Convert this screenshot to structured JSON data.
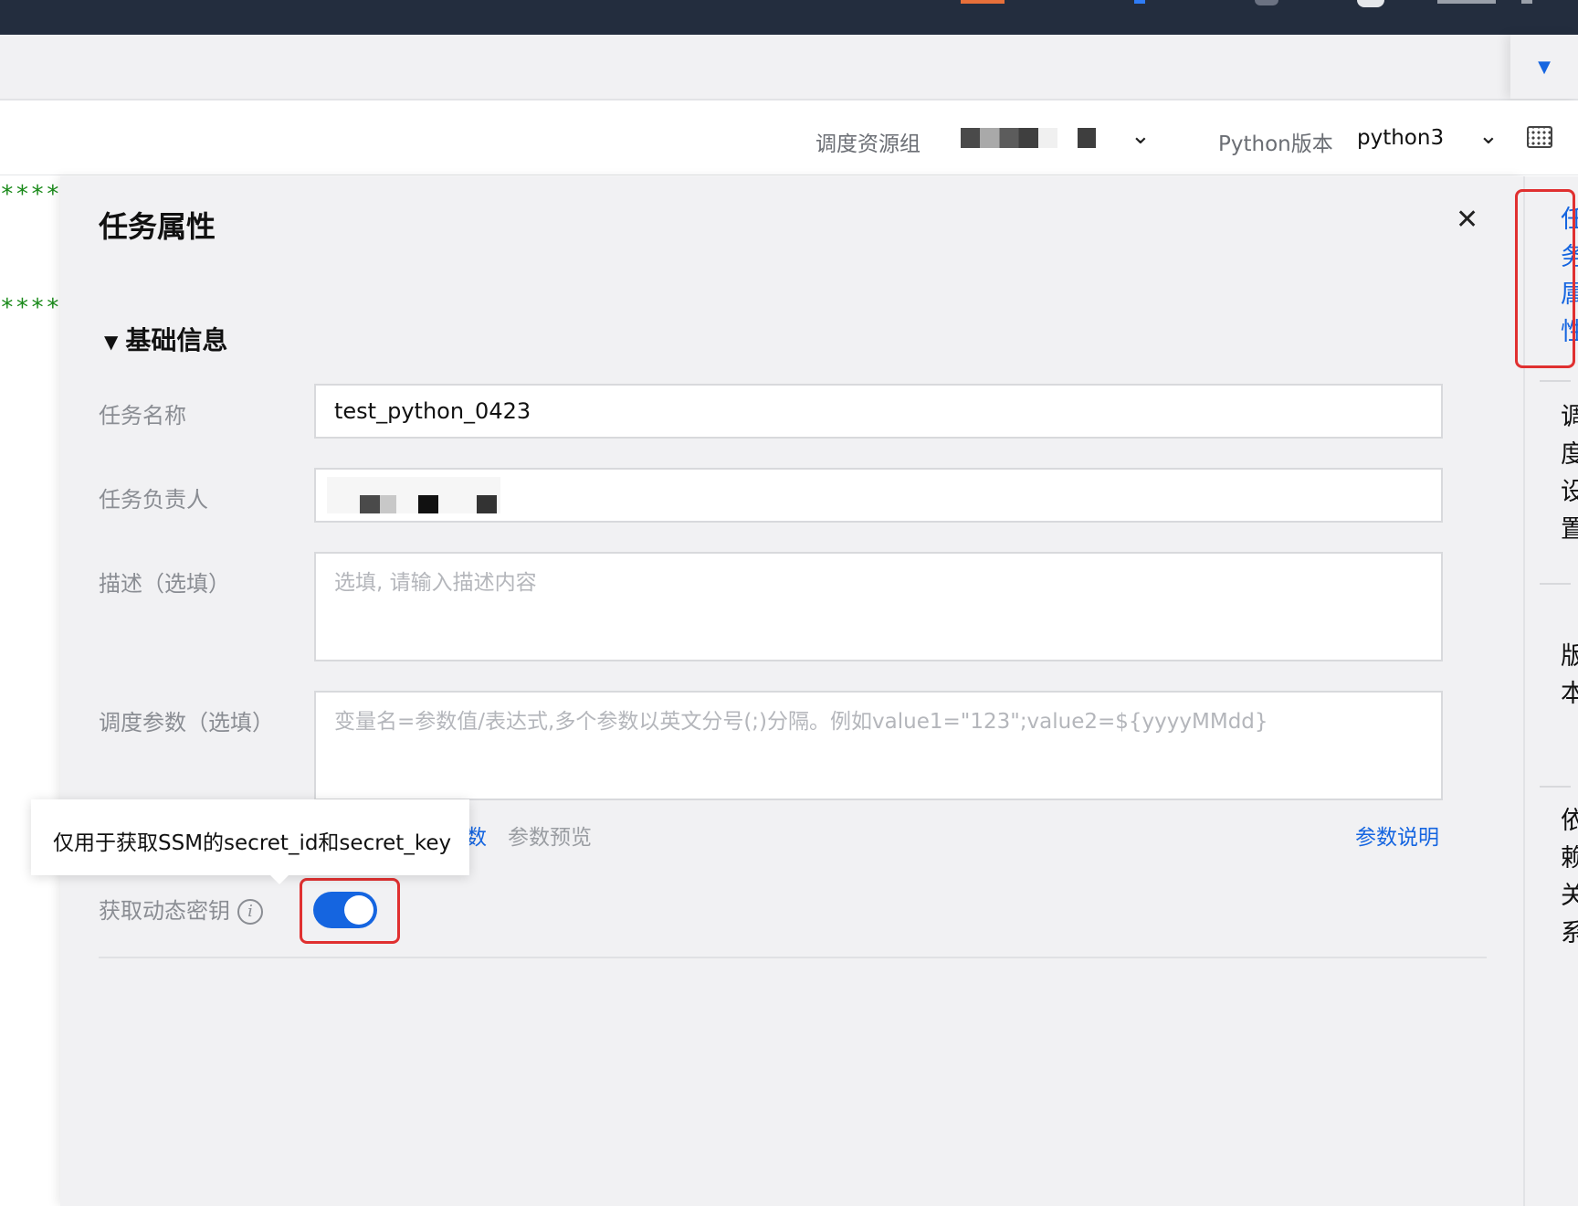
{
  "toolbar": {
    "resource_group_label": "调度资源组",
    "python_version_label": "Python版本",
    "python_version_value": "python3"
  },
  "editor": {
    "stars_line_1": "****",
    "stars_line_2": "****"
  },
  "panel": {
    "title": "任务属性",
    "section_title": "基础信息",
    "fields": {
      "task_name_label": "任务名称",
      "task_name_value": "test_python_0423",
      "owner_label": "任务负责人",
      "description_label": "描述（选填）",
      "description_placeholder": "选填, 请输入描述内容",
      "params_label": "调度参数（选填）",
      "params_placeholder": "变量名=参数值/表达式,多个参数以英文分号(;)分隔。例如value1=\"123\";value2=${yyyyMMdd}",
      "dynamic_key_label": "获取动态密钥",
      "dynamic_key_enabled": true
    },
    "links": {
      "partial_link": "数",
      "param_preview": "参数预览",
      "param_help": "参数说明"
    },
    "tooltip": "仅用于获取SSM的secret_id和secret_key"
  },
  "sidebar": {
    "items": [
      {
        "label": "任务属性",
        "active": true
      },
      {
        "label": "调度设置"
      },
      {
        "label": "版本"
      },
      {
        "label": "依赖关系"
      }
    ]
  },
  "colors": {
    "accent": "#1565e0",
    "highlight": "#e03030",
    "topbar": "#232d3e"
  }
}
